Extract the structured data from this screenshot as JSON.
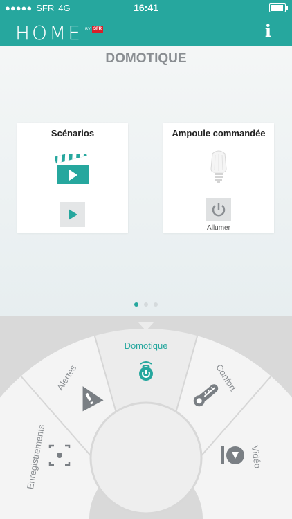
{
  "status_bar": {
    "carrier": "SFR",
    "network": "4G",
    "time": "16:41"
  },
  "header": {
    "logo_text": "HOME",
    "logo_by": "BY",
    "logo_brand": "SFR",
    "info_label": "i"
  },
  "page": {
    "title": "DOMOTIQUE",
    "pagination": {
      "total": 3,
      "active": 1
    }
  },
  "cards": [
    {
      "title": "Scénarios",
      "icon": "clapperboard-icon",
      "action_icon": "play-icon"
    },
    {
      "title": "Ampoule commandée",
      "icon": "lightbulb-icon",
      "action_icon": "power-icon",
      "action_label": "Allumer"
    }
  ],
  "menu": {
    "items": [
      {
        "label": "Enregistrements",
        "icon": "record-icon"
      },
      {
        "label": "Alertes",
        "icon": "alert-icon"
      },
      {
        "label": "Domotique",
        "icon": "remote-power-icon",
        "active": true
      },
      {
        "label": "Confort",
        "icon": "thermometer-icon"
      },
      {
        "label": "Vidéo",
        "icon": "camera-icon"
      }
    ]
  },
  "colors": {
    "accent": "#26a79e",
    "icon_gray": "#7a7f84",
    "title_gray": "#8a8e92"
  }
}
